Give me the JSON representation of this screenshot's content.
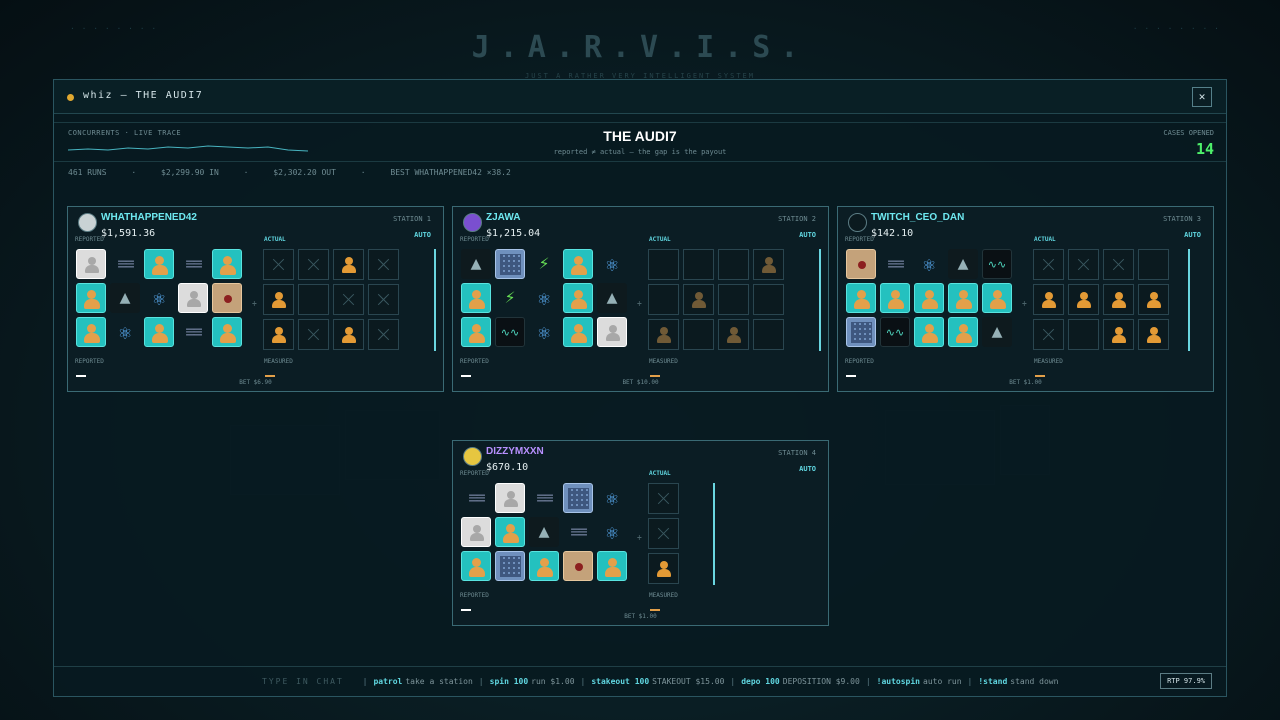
{
  "background": {
    "brand_title": "J.A.R.V.I.S.",
    "brand_subtitle": "JUST A RATHER VERY INTELLIGENT SYSTEM"
  },
  "window": {
    "title": "whiz — THE AUDI7",
    "close_glyph": "✕"
  },
  "header": {
    "concurrents_label": "CONCURRENTS · LIVE TRACE",
    "title": "THE AUDI7",
    "subtitle": "reported ≠ actual — the gap is the payout",
    "cases_label": "CASES OPENED",
    "cases_value": "14"
  },
  "stats": {
    "runs": "461 RUNS",
    "sep": "·",
    "in": "$2,299.90 IN",
    "out": "$2,302.20 OUT",
    "best": "BEST WHATHAPPENED42 ×38.2"
  },
  "colors": {
    "accent": "#60d6e0",
    "cases_green": "#4df06a",
    "face_orange": "#e3a04a",
    "tile_teal": "#24c1bf"
  },
  "labels": {
    "reported": "REPORTED",
    "actual": "ACTUAL",
    "measured": "MEASURED",
    "auto": "AUTO",
    "colon": "÷"
  },
  "stations": [
    {
      "name": "WHATHAPPENED42",
      "name_color": "#6ee8f0",
      "avatar_color": "#c9d2d4",
      "number": "STATION 1",
      "balance": "$1,591.36",
      "bet": "BET $6.90",
      "reported": [
        "card",
        "stack",
        "face",
        "stack",
        "face",
        "face",
        "hood",
        "atom",
        "card",
        "doc",
        "face",
        "atom",
        "face",
        "stack",
        "face"
      ],
      "actual": [
        "x",
        "x",
        "face",
        "x",
        "face",
        "empty",
        "x",
        "x",
        "face",
        "x",
        "face",
        "x"
      ]
    },
    {
      "name": "ZJAWA",
      "name_color": "#6ee8f0",
      "avatar_color": "#7a4fd0",
      "number": "STATION 2",
      "balance": "$1,215.04",
      "bet": "BET $10.00",
      "reported": [
        "hood",
        "grid",
        "bolt",
        "face",
        "atom",
        "face",
        "bolt",
        "atom",
        "face",
        "hood",
        "face",
        "wave",
        "atom",
        "face",
        "card"
      ],
      "actual": [
        "empty",
        "empty",
        "empty",
        "facedim",
        "empty",
        "facedim",
        "empty",
        "empty",
        "facedim",
        "empty",
        "facedim",
        "empty"
      ]
    },
    {
      "name": "TWITCH_CEO_DAN",
      "name_color": "#6ee8f0",
      "avatar_color": "#0b1a1f",
      "number": "STATION 3",
      "balance": "$142.10",
      "bet": "BET $1.00",
      "reported": [
        "doc",
        "stack",
        "atom",
        "hood",
        "wave",
        "face",
        "face",
        "face",
        "face",
        "face",
        "grid",
        "wave",
        "face",
        "face",
        "hood"
      ],
      "actual": [
        "x",
        "x",
        "x",
        "empty",
        "face",
        "face",
        "face",
        "face",
        "x",
        "empty",
        "face",
        "face"
      ]
    },
    {
      "name": "DIZZYMXXN",
      "name_color": "#b890ff",
      "avatar_color": "#e6c640",
      "number": "STATION 4",
      "balance": "$670.10",
      "bet": "BET $1.00",
      "reported": [
        "stack",
        "card",
        "stack",
        "grid",
        "atom",
        "card",
        "face",
        "hood",
        "stack",
        "atom",
        "face",
        "grid",
        "face",
        "doc",
        "face"
      ],
      "actual": [
        "x",
        "none",
        "none",
        "none",
        "x",
        "none",
        "none",
        "none",
        "face",
        "none",
        "none",
        "none"
      ]
    }
  ],
  "footer": {
    "prompt": "TYPE IN CHAT",
    "commands": [
      {
        "cmd": "patrol",
        "desc": "take a station"
      },
      {
        "cmd": "spin 100",
        "desc": "run $1.00"
      },
      {
        "cmd": "stakeout 100",
        "desc": "STAKEOUT $15.00"
      },
      {
        "cmd": "depo 100",
        "desc": "DEPOSITION $9.00"
      },
      {
        "cmd": "!autospin",
        "desc": "auto run"
      },
      {
        "cmd": "!stand",
        "desc": "stand down"
      }
    ],
    "rtp": "RTP 97.9%"
  }
}
